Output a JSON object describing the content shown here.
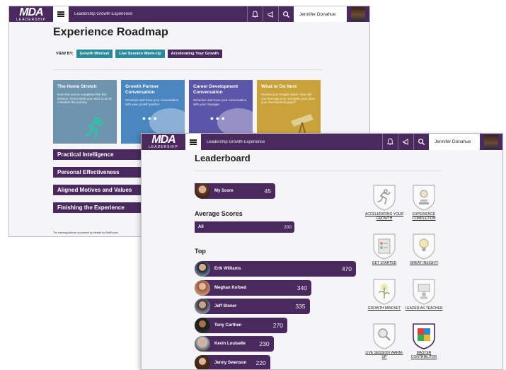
{
  "colors": {
    "brand": "#4a2a5e",
    "teal": "#2b8a9a",
    "bg": "#f5f5f7"
  },
  "roadmap": {
    "header": {
      "logo": "MDA",
      "logo_sub": "LEADERSHIP",
      "breadcrumb": "Leadership Growth Experience",
      "user": "Jennifer Donahue",
      "icons": [
        "bell-icon",
        "megaphone-icon",
        "search-icon"
      ]
    },
    "title": "Experience Roadmap",
    "view_by_label": "VIEW BY:",
    "view_by": [
      "Growth Mindset",
      "Live Session Warm-Up",
      "Accelerating Your Growth"
    ],
    "cards": [
      {
        "title": "The Home Stretch",
        "desc": "Now that you've completed the live session, here's what you need to do to complete the journey."
      },
      {
        "title": "Growth Partner Conversation",
        "desc": "Schedule and have your conversation with your growth partner."
      },
      {
        "title": "Career Development Conversation",
        "desc": "Schedule and have your conversation with your manager."
      },
      {
        "title": "What to Do Next",
        "desc": "Review your Insight report. How will you leverage your strengths and close your development gaps?"
      }
    ],
    "sections": [
      "Practical Intelligence",
      "Personal Effectiveness",
      "Aligned Motives and Values",
      "Finishing the Experience"
    ],
    "footer": "The learning platform is powered by Intrepid by VitalSource."
  },
  "leaderboard": {
    "header": {
      "logo": "MDA",
      "logo_sub": "LEADERSHIP",
      "breadcrumb": "Leadership Growth Experience",
      "user": "Jennifer Donahue",
      "icons": [
        "bell-icon",
        "megaphone-icon",
        "search-icon"
      ]
    },
    "title": "Leaderboard",
    "my_score": {
      "label": "My Score",
      "value": "45"
    },
    "average_title": "Average Scores",
    "average": {
      "label": "All",
      "value": "200"
    },
    "top_title": "Top",
    "top": [
      {
        "name": "Erik Williams",
        "score": "470",
        "score_num": 470
      },
      {
        "name": "Meghan Kofoed",
        "score": "340",
        "score_num": 340
      },
      {
        "name": "Jeff Stoner",
        "score": "335",
        "score_num": 335
      },
      {
        "name": "Tony Carthen",
        "score": "270",
        "score_num": 270
      },
      {
        "name": "Kevin Louiselle",
        "score": "230",
        "score_num": 230
      },
      {
        "name": "Jenny Swenson",
        "score": "220",
        "score_num": 220
      }
    ],
    "badges": [
      {
        "label": "ACCELERATING YOUR GROWTH",
        "icon": "runner-icon"
      },
      {
        "label": "EXPERIENCE COMPLETION",
        "icon": "medal-icon"
      },
      {
        "label": "GET STARTED",
        "icon": "checklist-icon"
      },
      {
        "label": "GREAT INSIGHT!",
        "icon": "lightbulb-icon"
      },
      {
        "label": "GROWTH MINDSET",
        "icon": "plant-icon"
      },
      {
        "label": "LEADER AS TEACHER",
        "icon": "teacher-icon"
      },
      {
        "label": "LIVE SESSION WARM-UP",
        "icon": "magnifier-icon"
      },
      {
        "label": "MASTER CONTRIBUTOR",
        "icon": "puzzle-icon"
      }
    ]
  }
}
